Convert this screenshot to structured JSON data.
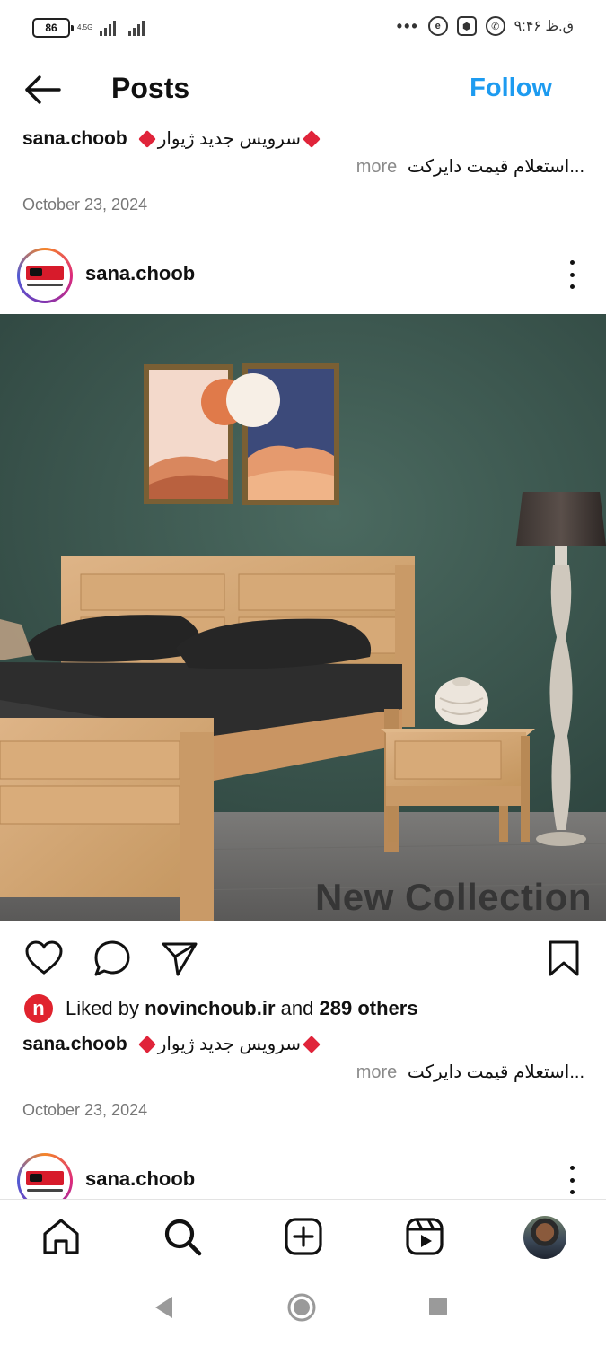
{
  "status_bar": {
    "battery": "86",
    "network": "4.5G",
    "time": "۹:۴۶ ق.ظ",
    "more": "•••"
  },
  "header": {
    "title": "Posts",
    "follow": "Follow"
  },
  "posts": [
    {
      "username": "sana.choob",
      "caption_line1": "سرویس جدید ژیوار",
      "caption_line2": "استعلام قیمت دایرکت...",
      "more": "more",
      "date": "October 23, 2024"
    },
    {
      "username": "sana.choob",
      "image_overlay": "New Collection",
      "liked_by_prefix": "Liked by",
      "liked_by_user": "novinchoub.ir",
      "liked_by_and": "and",
      "liked_by_others": "289 others",
      "caption_line1": "سرویس جدید ژیوار",
      "caption_line2": "استعلام قیمت دایرکت...",
      "more": "more",
      "date": "October 23, 2024"
    },
    {
      "username": "sana.choob"
    }
  ],
  "colors": {
    "accent": "#1d9bf0",
    "wall": "#3f5a52",
    "wood": "#d4a878",
    "like_avatar": "#e0232e",
    "diamond": "#e0243a"
  },
  "icons": {
    "back": "arrow-left-icon",
    "more": "kebab-icon",
    "like": "heart-icon",
    "comment": "comment-icon",
    "share": "send-icon",
    "save": "bookmark-icon",
    "home": "home-icon",
    "search": "search-icon",
    "create": "plus-square-icon",
    "reels": "reels-icon"
  }
}
